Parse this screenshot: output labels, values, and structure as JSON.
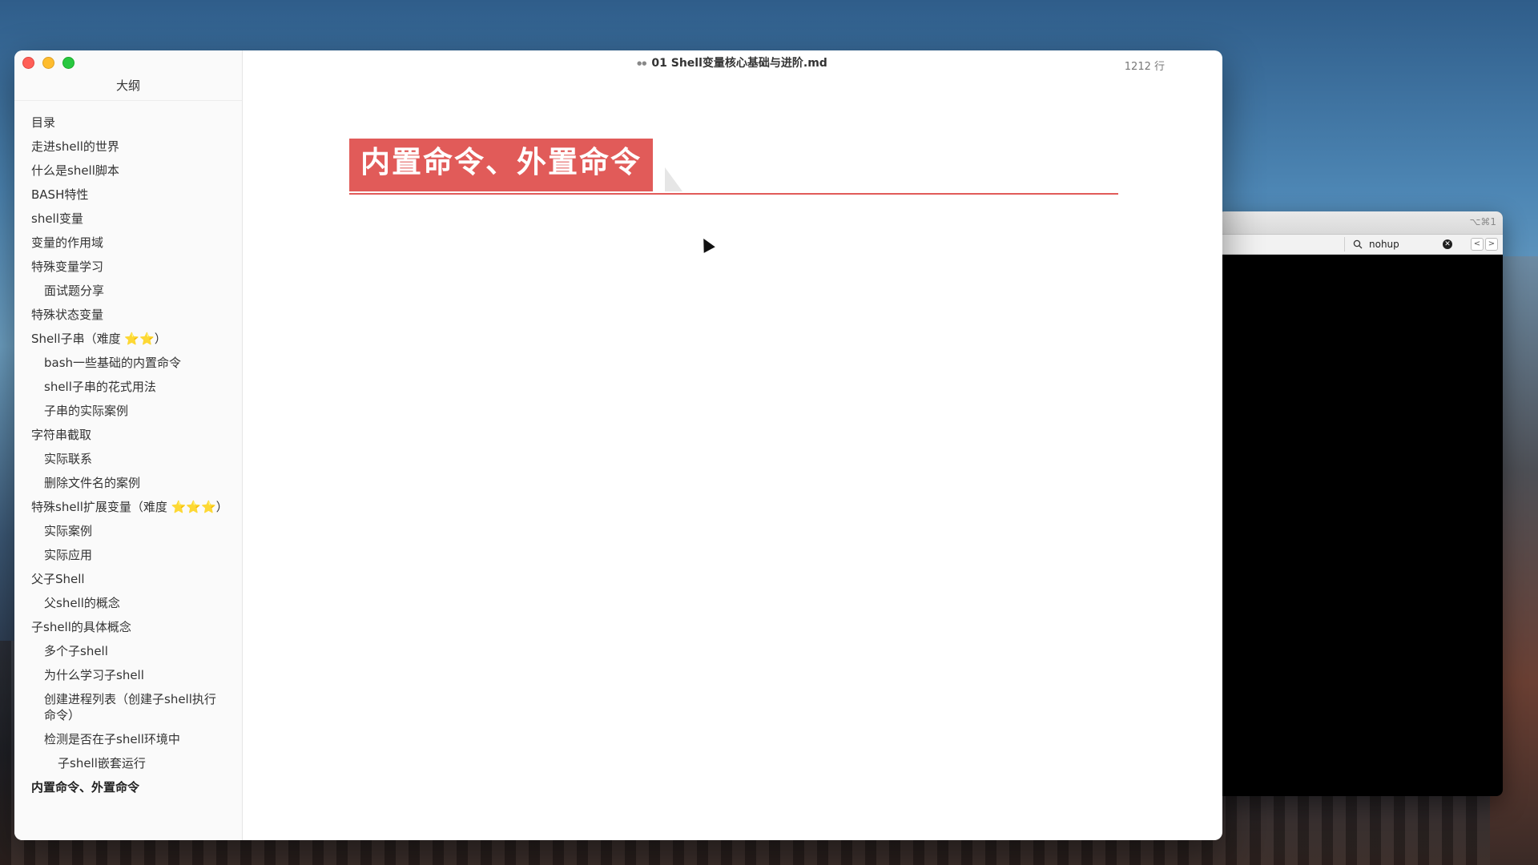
{
  "terminal": {
    "shortcut": "⌥⌘1",
    "search_value": "nohup",
    "prev_label": "<",
    "next_label": ">"
  },
  "editor": {
    "window_title": "01 Shell变量核心基础与进阶.md",
    "line_count": "1212 行",
    "sidebar_title": "大纲",
    "heading": "内置命令、外置命令"
  },
  "outline": [
    {
      "label": "目录",
      "level": 1
    },
    {
      "label": "走进shell的世界",
      "level": 1
    },
    {
      "label": "什么是shell脚本",
      "level": 1
    },
    {
      "label": "BASH特性",
      "level": 1
    },
    {
      "label": "shell变量",
      "level": 1
    },
    {
      "label": "变量的作用域",
      "level": 1
    },
    {
      "label": "特殊变量学习",
      "level": 1
    },
    {
      "label": "面试题分享",
      "level": 2
    },
    {
      "label": "特殊状态变量",
      "level": 1
    },
    {
      "label": "Shell子串（难度 ⭐⭐）",
      "level": 1
    },
    {
      "label": "bash一些基础的内置命令",
      "level": 2
    },
    {
      "label": "shell子串的花式用法",
      "level": 2
    },
    {
      "label": "子串的实际案例",
      "level": 2
    },
    {
      "label": "字符串截取",
      "level": 1
    },
    {
      "label": "实际联系",
      "level": 2
    },
    {
      "label": "删除文件名的案例",
      "level": 2
    },
    {
      "label": "特殊shell扩展变量（难度 ⭐⭐⭐）",
      "level": 1
    },
    {
      "label": "实际案例",
      "level": 2
    },
    {
      "label": "实际应用",
      "level": 2
    },
    {
      "label": "父子Shell",
      "level": 1
    },
    {
      "label": "父shell的概念",
      "level": 2
    },
    {
      "label": "子shell的具体概念",
      "level": 1
    },
    {
      "label": "多个子shell",
      "level": 2
    },
    {
      "label": "为什么学习子shell",
      "level": 2
    },
    {
      "label": "创建进程列表（创建子shell执行命令）",
      "level": 2
    },
    {
      "label": "检测是否在子shell环境中",
      "level": 2
    },
    {
      "label": "子shell嵌套运行",
      "level": 3
    },
    {
      "label": "内置命令、外置命令",
      "level": 1,
      "active": true
    }
  ]
}
